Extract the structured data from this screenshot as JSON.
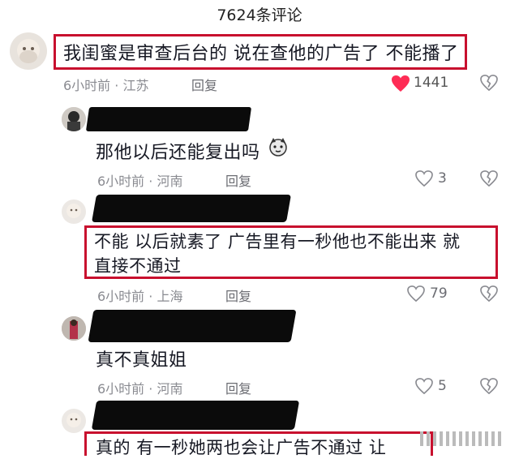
{
  "header": {
    "title": "7624条评论"
  },
  "comments": [
    {
      "text": "我闺蜜是审查后台的 说在查他的广告了 不能播了",
      "time": "6小时前 · 江苏",
      "reply": "回复",
      "likes": "1441"
    },
    {
      "text": "那他以后还能复出吗",
      "time": "6小时前 · 河南",
      "reply": "回复",
      "likes": "3"
    },
    {
      "text_line1": "不能 以后就素了 广告里有一秒他也不能出来 就",
      "text_line2": "直接不通过",
      "time": "6小时前 · 上海",
      "reply": "回复",
      "likes": "79"
    },
    {
      "text": "真不真姐姐",
      "time": "6小时前 · 河南",
      "reply": "回复",
      "likes": "5"
    },
    {
      "text": "真的 有一秒她两也会让广告不通过 让"
    }
  ],
  "colors": {
    "highlight": "#c8102e",
    "liked": "#fe2c55",
    "meta": "#8a8b91"
  },
  "icons": [
    "heart-icon",
    "dislike-icon",
    "emoji-icon"
  ]
}
